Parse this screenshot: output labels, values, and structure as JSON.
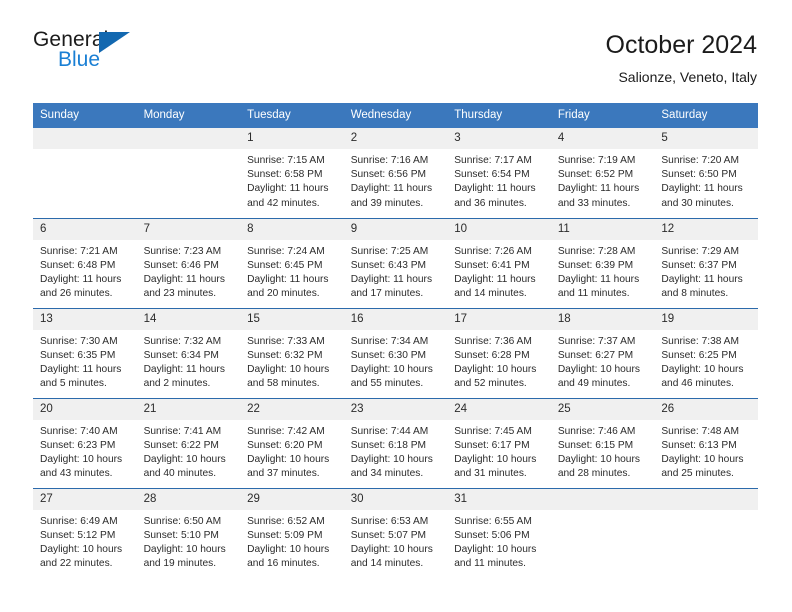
{
  "logo": {
    "word_one": "General",
    "word_two": "Blue",
    "triangle_icon": "blue-triangle-icon",
    "color_black": "#1b1b1b",
    "color_blue": "#1a7fd4"
  },
  "header": {
    "title": "October 2024",
    "location": "Salionze, Veneto, Italy"
  },
  "theme": {
    "header_blue": "#3b78bd",
    "row_divider": "#2c6aab",
    "daynum_band": "#f0f0f0",
    "text": "#2b2b2b"
  },
  "weekdays": [
    "Sunday",
    "Monday",
    "Tuesday",
    "Wednesday",
    "Thursday",
    "Friday",
    "Saturday"
  ],
  "labels": {
    "sunrise": "Sunrise:",
    "sunset": "Sunset:",
    "daylight": "Daylight:"
  },
  "weeks": [
    [
      {
        "day": "",
        "blank": true
      },
      {
        "day": "",
        "blank": true
      },
      {
        "day": "1",
        "sunrise": "Sunrise: 7:15 AM",
        "sunset": "Sunset: 6:58 PM",
        "daylight": "Daylight: 11 hours and 42 minutes."
      },
      {
        "day": "2",
        "sunrise": "Sunrise: 7:16 AM",
        "sunset": "Sunset: 6:56 PM",
        "daylight": "Daylight: 11 hours and 39 minutes."
      },
      {
        "day": "3",
        "sunrise": "Sunrise: 7:17 AM",
        "sunset": "Sunset: 6:54 PM",
        "daylight": "Daylight: 11 hours and 36 minutes."
      },
      {
        "day": "4",
        "sunrise": "Sunrise: 7:19 AM",
        "sunset": "Sunset: 6:52 PM",
        "daylight": "Daylight: 11 hours and 33 minutes."
      },
      {
        "day": "5",
        "sunrise": "Sunrise: 7:20 AM",
        "sunset": "Sunset: 6:50 PM",
        "daylight": "Daylight: 11 hours and 30 minutes."
      }
    ],
    [
      {
        "day": "6",
        "sunrise": "Sunrise: 7:21 AM",
        "sunset": "Sunset: 6:48 PM",
        "daylight": "Daylight: 11 hours and 26 minutes."
      },
      {
        "day": "7",
        "sunrise": "Sunrise: 7:23 AM",
        "sunset": "Sunset: 6:46 PM",
        "daylight": "Daylight: 11 hours and 23 minutes."
      },
      {
        "day": "8",
        "sunrise": "Sunrise: 7:24 AM",
        "sunset": "Sunset: 6:45 PM",
        "daylight": "Daylight: 11 hours and 20 minutes."
      },
      {
        "day": "9",
        "sunrise": "Sunrise: 7:25 AM",
        "sunset": "Sunset: 6:43 PM",
        "daylight": "Daylight: 11 hours and 17 minutes."
      },
      {
        "day": "10",
        "sunrise": "Sunrise: 7:26 AM",
        "sunset": "Sunset: 6:41 PM",
        "daylight": "Daylight: 11 hours and 14 minutes."
      },
      {
        "day": "11",
        "sunrise": "Sunrise: 7:28 AM",
        "sunset": "Sunset: 6:39 PM",
        "daylight": "Daylight: 11 hours and 11 minutes."
      },
      {
        "day": "12",
        "sunrise": "Sunrise: 7:29 AM",
        "sunset": "Sunset: 6:37 PM",
        "daylight": "Daylight: 11 hours and 8 minutes."
      }
    ],
    [
      {
        "day": "13",
        "sunrise": "Sunrise: 7:30 AM",
        "sunset": "Sunset: 6:35 PM",
        "daylight": "Daylight: 11 hours and 5 minutes."
      },
      {
        "day": "14",
        "sunrise": "Sunrise: 7:32 AM",
        "sunset": "Sunset: 6:34 PM",
        "daylight": "Daylight: 11 hours and 2 minutes."
      },
      {
        "day": "15",
        "sunrise": "Sunrise: 7:33 AM",
        "sunset": "Sunset: 6:32 PM",
        "daylight": "Daylight: 10 hours and 58 minutes."
      },
      {
        "day": "16",
        "sunrise": "Sunrise: 7:34 AM",
        "sunset": "Sunset: 6:30 PM",
        "daylight": "Daylight: 10 hours and 55 minutes."
      },
      {
        "day": "17",
        "sunrise": "Sunrise: 7:36 AM",
        "sunset": "Sunset: 6:28 PM",
        "daylight": "Daylight: 10 hours and 52 minutes."
      },
      {
        "day": "18",
        "sunrise": "Sunrise: 7:37 AM",
        "sunset": "Sunset: 6:27 PM",
        "daylight": "Daylight: 10 hours and 49 minutes."
      },
      {
        "day": "19",
        "sunrise": "Sunrise: 7:38 AM",
        "sunset": "Sunset: 6:25 PM",
        "daylight": "Daylight: 10 hours and 46 minutes."
      }
    ],
    [
      {
        "day": "20",
        "sunrise": "Sunrise: 7:40 AM",
        "sunset": "Sunset: 6:23 PM",
        "daylight": "Daylight: 10 hours and 43 minutes."
      },
      {
        "day": "21",
        "sunrise": "Sunrise: 7:41 AM",
        "sunset": "Sunset: 6:22 PM",
        "daylight": "Daylight: 10 hours and 40 minutes."
      },
      {
        "day": "22",
        "sunrise": "Sunrise: 7:42 AM",
        "sunset": "Sunset: 6:20 PM",
        "daylight": "Daylight: 10 hours and 37 minutes."
      },
      {
        "day": "23",
        "sunrise": "Sunrise: 7:44 AM",
        "sunset": "Sunset: 6:18 PM",
        "daylight": "Daylight: 10 hours and 34 minutes."
      },
      {
        "day": "24",
        "sunrise": "Sunrise: 7:45 AM",
        "sunset": "Sunset: 6:17 PM",
        "daylight": "Daylight: 10 hours and 31 minutes."
      },
      {
        "day": "25",
        "sunrise": "Sunrise: 7:46 AM",
        "sunset": "Sunset: 6:15 PM",
        "daylight": "Daylight: 10 hours and 28 minutes."
      },
      {
        "day": "26",
        "sunrise": "Sunrise: 7:48 AM",
        "sunset": "Sunset: 6:13 PM",
        "daylight": "Daylight: 10 hours and 25 minutes."
      }
    ],
    [
      {
        "day": "27",
        "sunrise": "Sunrise: 6:49 AM",
        "sunset": "Sunset: 5:12 PM",
        "daylight": "Daylight: 10 hours and 22 minutes."
      },
      {
        "day": "28",
        "sunrise": "Sunrise: 6:50 AM",
        "sunset": "Sunset: 5:10 PM",
        "daylight": "Daylight: 10 hours and 19 minutes."
      },
      {
        "day": "29",
        "sunrise": "Sunrise: 6:52 AM",
        "sunset": "Sunset: 5:09 PM",
        "daylight": "Daylight: 10 hours and 16 minutes."
      },
      {
        "day": "30",
        "sunrise": "Sunrise: 6:53 AM",
        "sunset": "Sunset: 5:07 PM",
        "daylight": "Daylight: 10 hours and 14 minutes."
      },
      {
        "day": "31",
        "sunrise": "Sunrise: 6:55 AM",
        "sunset": "Sunset: 5:06 PM",
        "daylight": "Daylight: 10 hours and 11 minutes."
      },
      {
        "day": "",
        "blank": true
      },
      {
        "day": "",
        "blank": true
      }
    ]
  ]
}
